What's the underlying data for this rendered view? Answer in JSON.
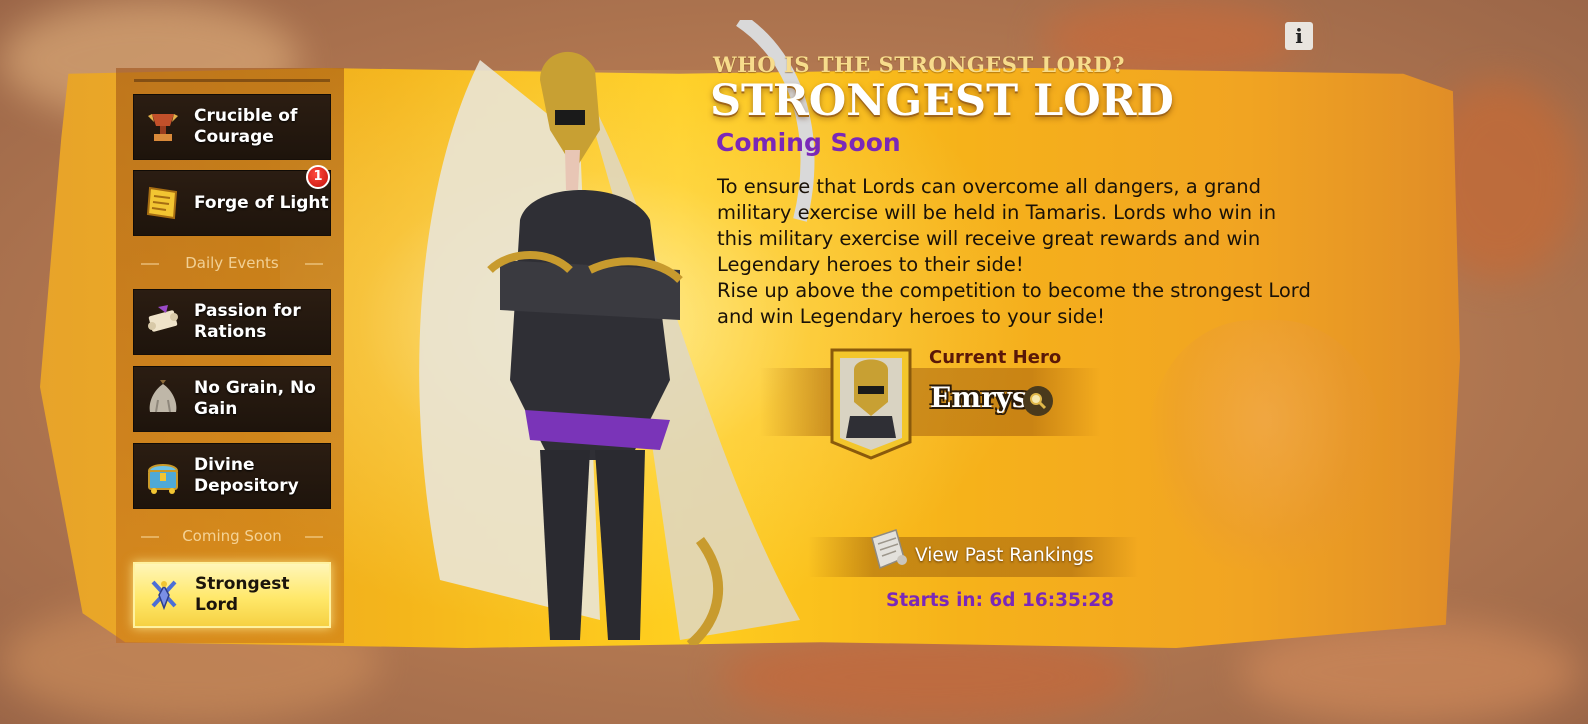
{
  "info_button": {
    "label": "i",
    "icon": "info-icon"
  },
  "sidebar": {
    "items": [
      {
        "label": "Crucible of Courage",
        "icon": "crucible-trophy-icon"
      },
      {
        "label": "Forge of Light",
        "icon": "golden-scroll-icon",
        "badge": "1"
      },
      {
        "label": "Passion for Rations",
        "icon": "paper-scroll-icon"
      },
      {
        "label": "No Grain, No Gain",
        "icon": "grain-sack-icon"
      },
      {
        "label": "Divine Depository",
        "icon": "treasure-chest-icon"
      },
      {
        "label": "Strongest Lord",
        "icon": "crossed-swords-icon",
        "active": true
      }
    ],
    "sections": [
      "Daily Events",
      "Coming Soon"
    ]
  },
  "event": {
    "subtitle": "WHO IS THE STRONGEST LORD?",
    "title": "STRONGEST LORD",
    "status": "Coming Soon",
    "description_1": "To ensure that Lords can overcome all dangers, a grand military exercise will be held in Tamaris. Lords who win in this military exercise will receive great rewards and win Legendary heroes to their side!",
    "description_2": "Rise up above the competition to become the strongest Lord and win Legendary heroes to your side!"
  },
  "current_hero": {
    "label": "Current Hero",
    "name": "Emrys",
    "icon": "magnifier-icon"
  },
  "rankings": {
    "label": "View Past Rankings",
    "icon": "scroll-icon"
  },
  "countdown": {
    "text": "Starts in: 6d 16:35:28"
  },
  "colors": {
    "accent_purple": "#7a28b8",
    "banner_gold": "#ffcf1f",
    "nav_dark": "#2b1d12",
    "nav_active": "#ffe86a",
    "badge_red": "#d61a12"
  }
}
